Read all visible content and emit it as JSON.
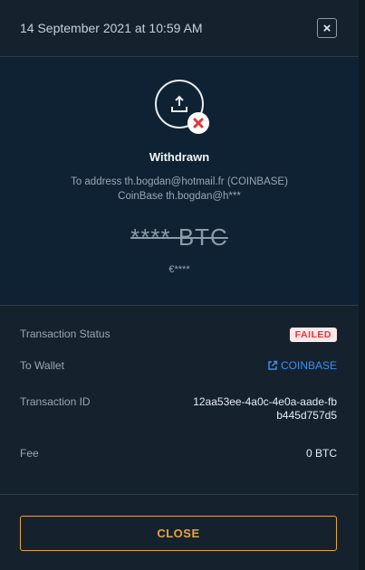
{
  "header": {
    "date": "14 September 2021 at 10:59 AM",
    "close_glyph": "×"
  },
  "summary": {
    "title": "Withdrawn",
    "address_line1": "To address th.bogdan@hotmail.fr (COINBASE)",
    "address_line2": "CoinBase th.bogdan@h***",
    "amount": "**** BTC",
    "fiat": "€****",
    "icon": "upload-icon",
    "status_icon": "failed-x-icon"
  },
  "details": {
    "status_label": "Transaction Status",
    "status_value": "FAILED",
    "wallet_label": "To Wallet",
    "wallet_value": "COINBASE",
    "wallet_icon": "external-link-icon",
    "txid_label": "Transaction ID",
    "txid_value": "12aa53ee-4a0c-4e0a-aade-fbb445d757d5",
    "fee_label": "Fee",
    "fee_value": "0 BTC"
  },
  "footer": {
    "close_label": "CLOSE"
  },
  "colors": {
    "accent": "#e8a43c",
    "link": "#3b8fe8",
    "failed": "#e2363f"
  }
}
